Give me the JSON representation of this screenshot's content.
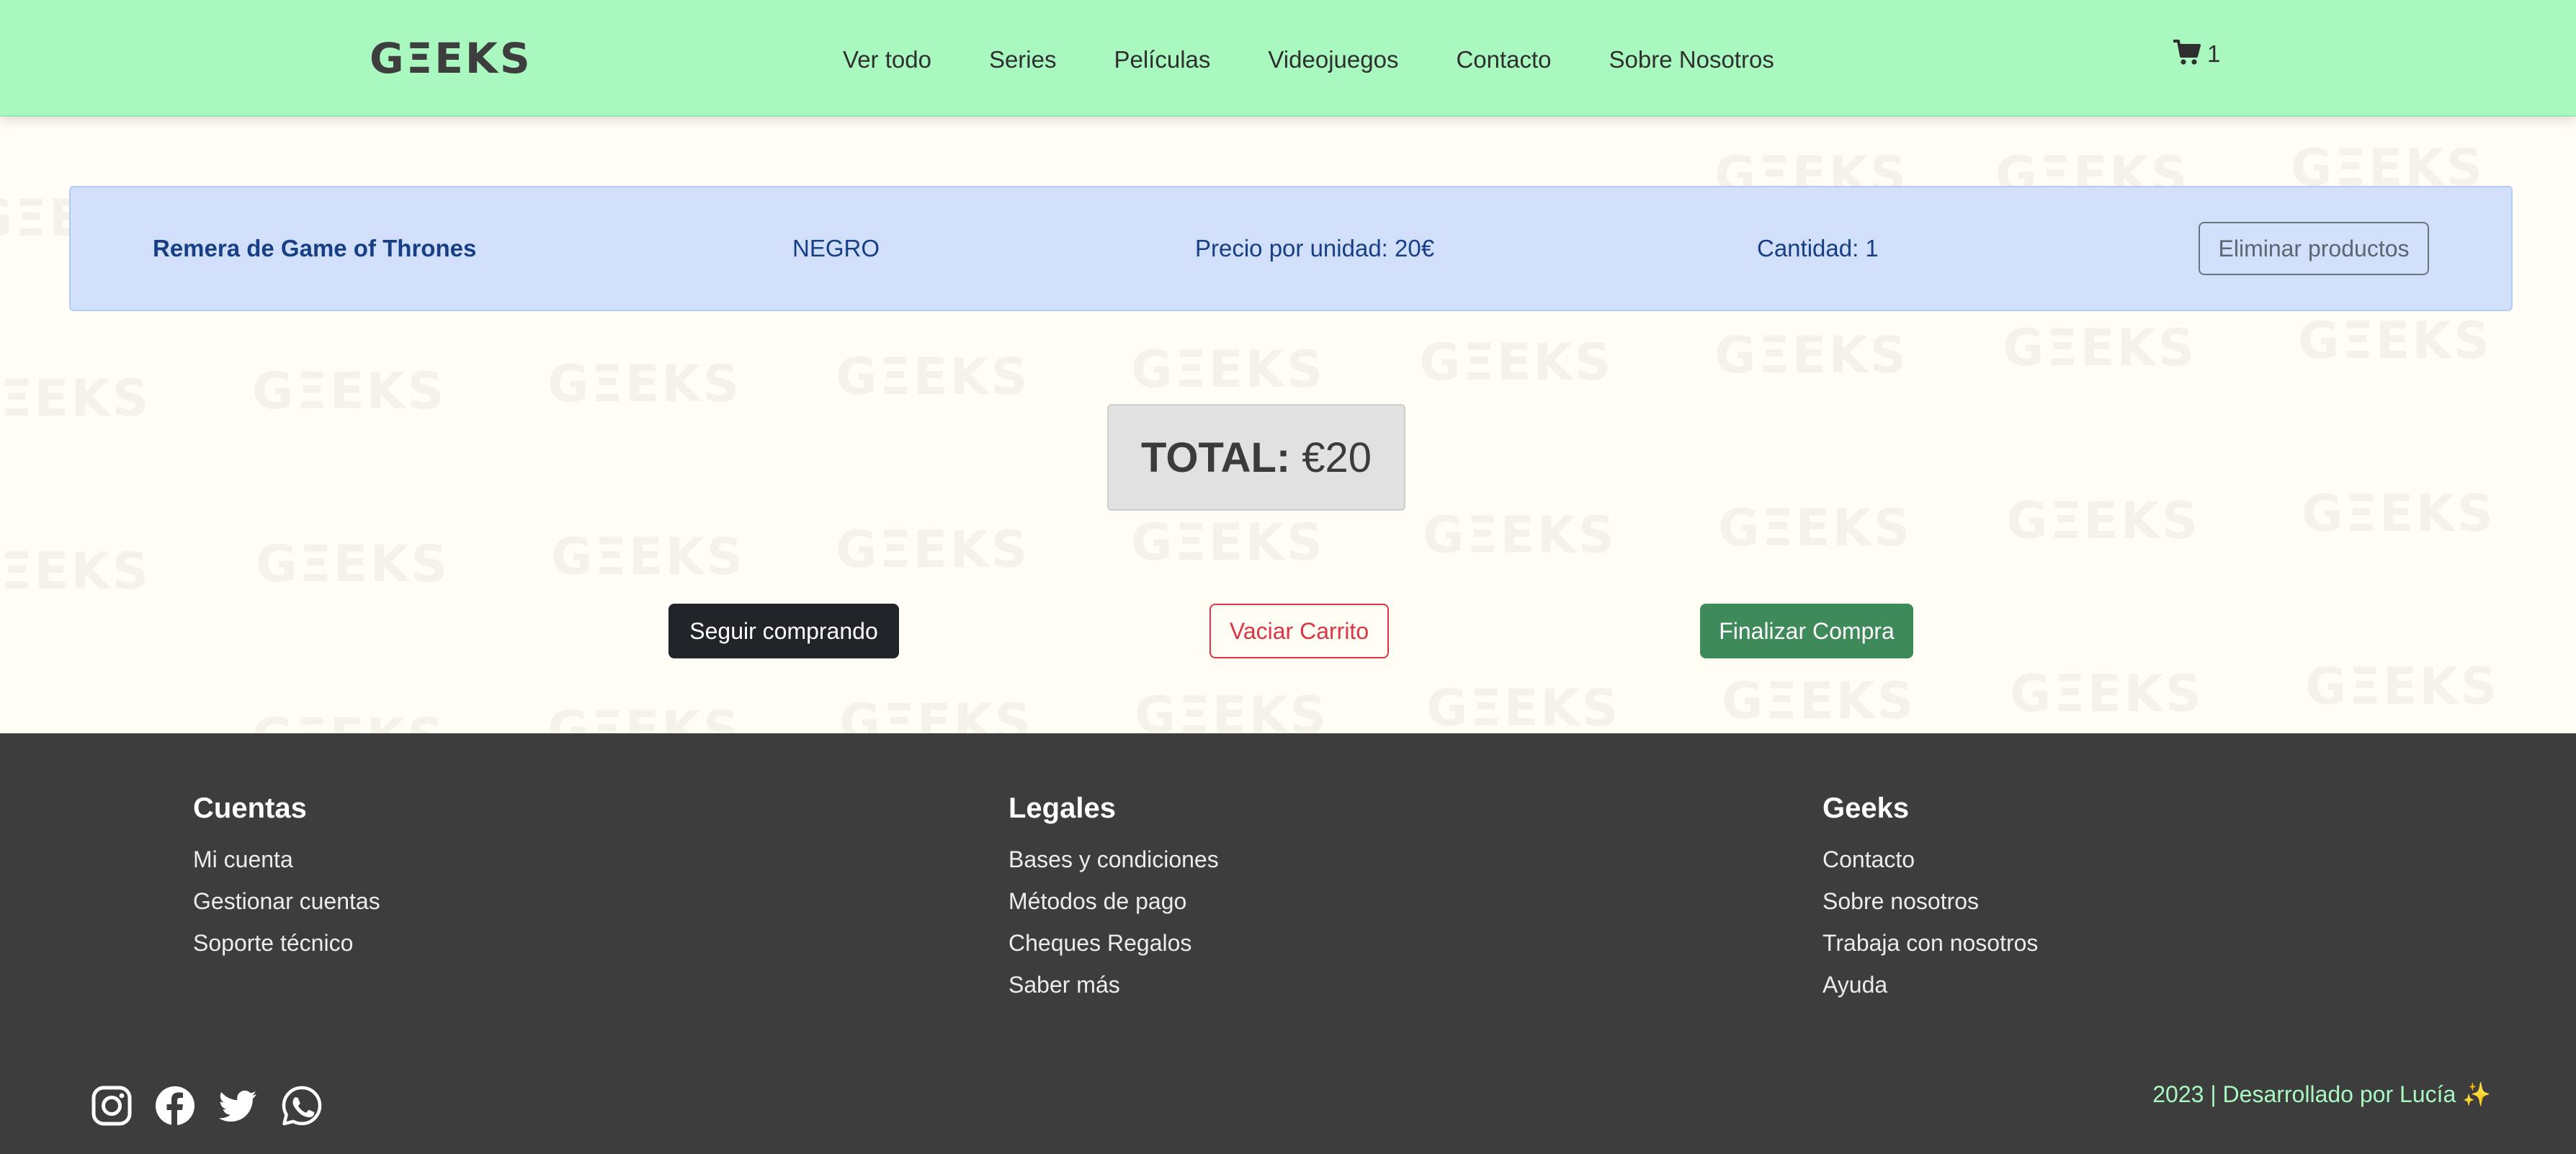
{
  "navbar": {
    "logo": "GΞEKS",
    "links": [
      "Ver todo",
      "Series",
      "Películas",
      "Videojuegos",
      "Contacto",
      "Sobre Nosotros"
    ],
    "cart_count": "1",
    "cart_icon": "shopping-cart-icon"
  },
  "background": {
    "watermark_text": "GΞEKS"
  },
  "cart_item": {
    "name": "Remera de Game of Thrones",
    "color": "NEGRO",
    "price": "Precio por unidad: 20€",
    "quantity": "Cantidad: 1",
    "remove_label": "Eliminar productos"
  },
  "total": {
    "label": "TOTAL:",
    "value": "€20"
  },
  "actions": {
    "continue_label": "Seguir comprando",
    "empty_label": "Vaciar Carrito",
    "checkout_label": "Finalizar Compra"
  },
  "footer": {
    "columns": [
      {
        "title": "Cuentas",
        "links": [
          "Mi cuenta",
          "Gestionar cuentas",
          "Soporte técnico"
        ]
      },
      {
        "title": "Legales",
        "links": [
          "Bases y condiciones",
          "Métodos de pago",
          "Cheques Regalos",
          "Saber más"
        ]
      },
      {
        "title": "Geeks",
        "links": [
          "Contacto",
          "Sobre nosotros",
          "Trabaja con nosotros",
          "Ayuda"
        ]
      }
    ],
    "socials": [
      "instagram-icon",
      "facebook-icon",
      "twitter-icon",
      "whatsapp-icon"
    ],
    "credit": "2023 | Desarrollado por Lucía ✨"
  },
  "colors": {
    "navbar": "#a9f8c0",
    "page_bg": "#fffdf4",
    "footer_bg": "#3d3d3d",
    "item_bg": "#d1dffb",
    "danger": "#dc3545",
    "success": "#3f8a5a",
    "credit": "#a9f8c0"
  }
}
